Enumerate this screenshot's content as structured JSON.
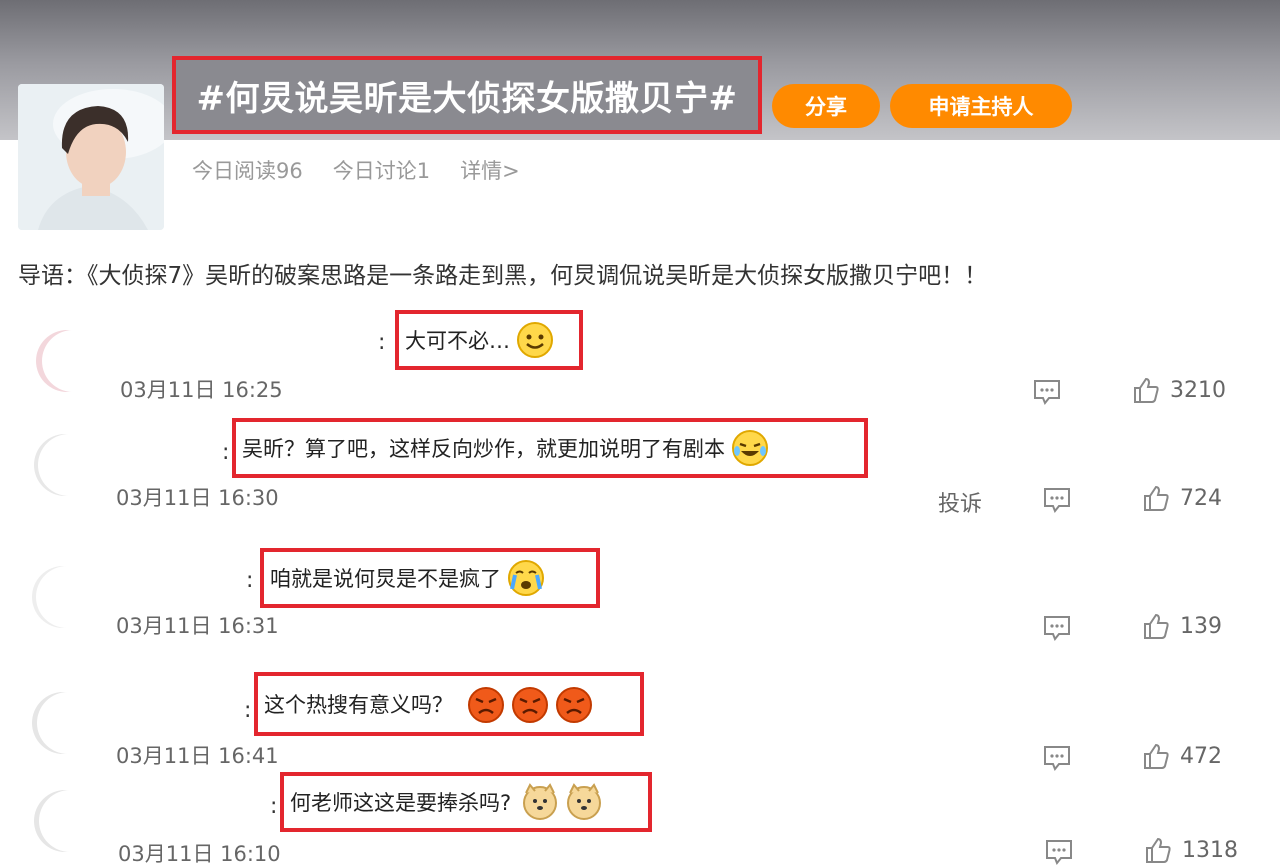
{
  "topic": {
    "title": "#何炅说吴昕是大侦探女版撒贝宁#",
    "share_label": "分享",
    "host_label": "申请主持人",
    "stats": {
      "reads": "今日阅读96",
      "discussions": "今日讨论1",
      "details": "详情>"
    }
  },
  "intro": "导语：《大侦探7》吴昕的破案思路是一条路走到黑，何炅调侃说吴昕是大侦探女版撒贝宁吧！！",
  "comments": [
    {
      "text": "大可不必…",
      "time": "03月11日 16:25",
      "likes": "3210"
    },
    {
      "text": "吴昕？算了吧，这样反向炒作，就更加说明了有剧本",
      "time": "03月11日 16:30",
      "likes": "724",
      "report": "投诉"
    },
    {
      "text": "咱就是说何炅是不是疯了",
      "time": "03月11日 16:31",
      "likes": "139"
    },
    {
      "text": "这个热搜有意义吗？",
      "time": "03月11日 16:41",
      "likes": "472"
    },
    {
      "text": "何老师这这是要捧杀吗?",
      "time": "03月11日 16:10",
      "likes": "1318"
    }
  ],
  "colors": {
    "accent": "#ff8a00",
    "highlight_box": "#e3262e"
  }
}
